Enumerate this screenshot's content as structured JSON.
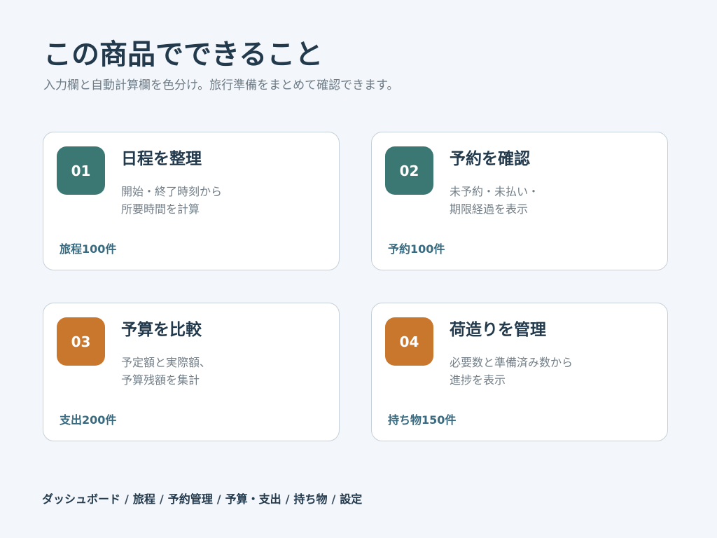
{
  "header": {
    "title": "この商品でできること",
    "subtitle": "入力欄と自動計算欄を色分け。旅行準備をまとめて確認できます。"
  },
  "cards": [
    {
      "number": "01",
      "title": "日程を整理",
      "description": [
        "開始・終了時刻から",
        "所要時間を計算"
      ],
      "stat": "旅程100件",
      "accent": "#3b7873"
    },
    {
      "number": "02",
      "title": "予約を確認",
      "description": [
        "未予約・未払い・",
        "期限経過を表示"
      ],
      "stat": "予約100件",
      "accent": "#3b7873"
    },
    {
      "number": "03",
      "title": "予算を比較",
      "description": [
        "予定額と実際額、",
        "予算残額を集計"
      ],
      "stat": "支出200件",
      "accent": "#c9772d"
    },
    {
      "number": "04",
      "title": "荷造りを管理",
      "description": [
        "必要数と準備済み数から",
        "進捗を表示"
      ],
      "stat": "持ち物150件",
      "accent": "#c9772d"
    }
  ],
  "breadcrumb": {
    "separator": "/",
    "items": [
      "ダッシュボード",
      "旅程",
      "予約管理",
      "予算・支出",
      "持ち物",
      "設定"
    ]
  }
}
